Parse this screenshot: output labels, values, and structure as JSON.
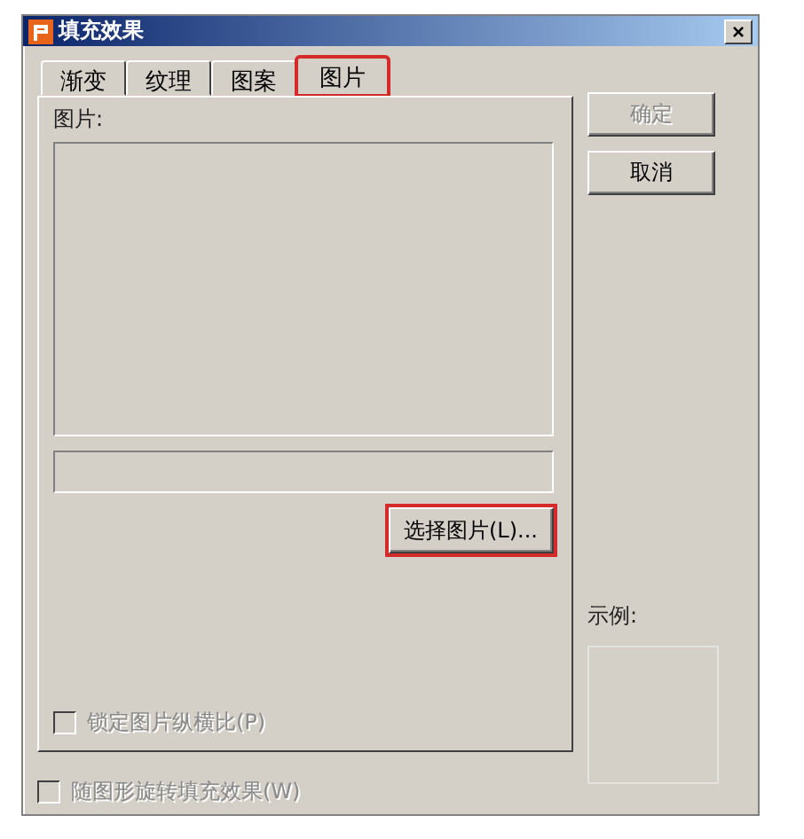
{
  "window": {
    "title": "填充效果",
    "close": "×"
  },
  "tabs": [
    {
      "label": "渐变",
      "selected": false,
      "highlighted": false
    },
    {
      "label": "纹理",
      "selected": false,
      "highlighted": false
    },
    {
      "label": "图案",
      "selected": false,
      "highlighted": false
    },
    {
      "label": "图片",
      "selected": true,
      "highlighted": true
    }
  ],
  "picture_label": "图片:",
  "choose_button": {
    "label": "选择图片(L)...",
    "highlighted": true
  },
  "lock_checkbox": {
    "label": "锁定图片纵横比(P)",
    "checked": false,
    "disabled": true
  },
  "rotate_checkbox": {
    "label": "随图形旋转填充效果(W)",
    "checked": false,
    "disabled": true
  },
  "buttons": [
    {
      "label": "确定",
      "disabled": true
    },
    {
      "label": "取消",
      "disabled": false
    }
  ],
  "sample_label": "示例:"
}
